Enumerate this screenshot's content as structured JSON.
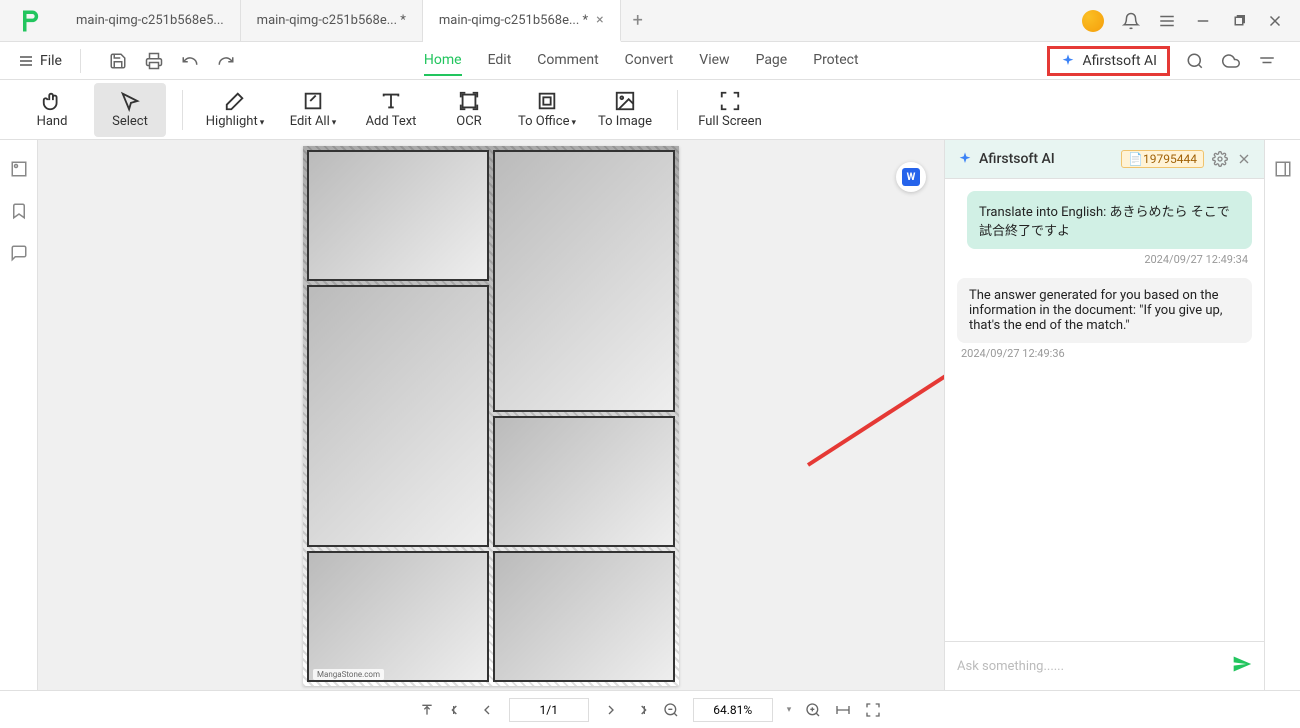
{
  "tabs": [
    {
      "label": "main-qimg-c251b568e5...",
      "modified": false,
      "active": false
    },
    {
      "label": "main-qimg-c251b568e... *",
      "modified": true,
      "active": false
    },
    {
      "label": "main-qimg-c251b568e... *",
      "modified": true,
      "active": true
    }
  ],
  "menu": {
    "file": "File",
    "items": [
      "Home",
      "Edit",
      "Comment",
      "Convert",
      "View",
      "Page",
      "Protect"
    ],
    "active": "Home",
    "ai_label": "Afirstsoft AI"
  },
  "toolbar": {
    "hand": "Hand",
    "select": "Select",
    "highlight": "Highlight",
    "edit_all": "Edit All",
    "add_text": "Add Text",
    "ocr": "OCR",
    "to_office": "To Office",
    "to_image": "To Image",
    "full_screen": "Full Screen"
  },
  "document": {
    "watermark": "MangaStone.com",
    "convert_badge": "W"
  },
  "ai": {
    "title": "Afirstsoft AI",
    "credits": "19795444",
    "user_msg": "Translate into English: あきらめたら そこで試合終了ですよ",
    "user_time": "2024/09/27 12:49:34",
    "ai_msg": "The answer generated for you based on the information in the document:\n\"If you give up, that's the end of the match.\"",
    "ai_time": "2024/09/27 12:49:36",
    "placeholder": "Ask something......"
  },
  "status": {
    "page": "1/1",
    "zoom": "64.81%"
  }
}
